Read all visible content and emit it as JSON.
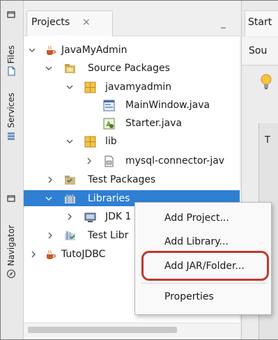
{
  "sidebar_tabs": {
    "files": "Files",
    "services": "Services",
    "navigator": "Navigator"
  },
  "projects_panel": {
    "tab_label": "Projects",
    "close_glyph": "×",
    "minimize_glyph": "_"
  },
  "tree": [
    {
      "label": "JavaMyAdmin",
      "icon": "java-project-icon",
      "expanded": true
    },
    {
      "label": "Source Packages",
      "icon": "source-packages-icon",
      "expanded": true
    },
    {
      "label": "javamyadmin",
      "icon": "package-icon",
      "expanded": true
    },
    {
      "label": "MainWindow.java",
      "icon": "java-form-icon"
    },
    {
      "label": "Starter.java",
      "icon": "java-class-icon"
    },
    {
      "label": "lib",
      "icon": "package-icon",
      "expanded": true
    },
    {
      "label": "mysql-connector-jav",
      "icon": "jar-file-icon",
      "expanded": false
    },
    {
      "label": "Test Packages",
      "icon": "test-packages-icon",
      "expanded": false
    },
    {
      "label": "Libraries",
      "icon": "libraries-icon",
      "expanded": true,
      "selected": true
    },
    {
      "label": "JDK 1",
      "icon": "jdk-icon",
      "expanded": false
    },
    {
      "label": "Test Libr",
      "icon": "test-libraries-icon",
      "expanded": false
    },
    {
      "label": "TutoJDBC",
      "icon": "java-project-icon",
      "expanded": false
    }
  ],
  "right_area": {
    "tab_label": "Start",
    "subtab_label": "Sou",
    "panel_label": "T"
  },
  "context_menu": {
    "items": [
      "Add Project...",
      "Add Library...",
      "Add JAR/Folder...",
      "Properties"
    ],
    "highlighted_item": "Add JAR/Folder..."
  },
  "colors": {
    "selection": "#2f7fd3",
    "highlight_ring": "#c0392b"
  }
}
